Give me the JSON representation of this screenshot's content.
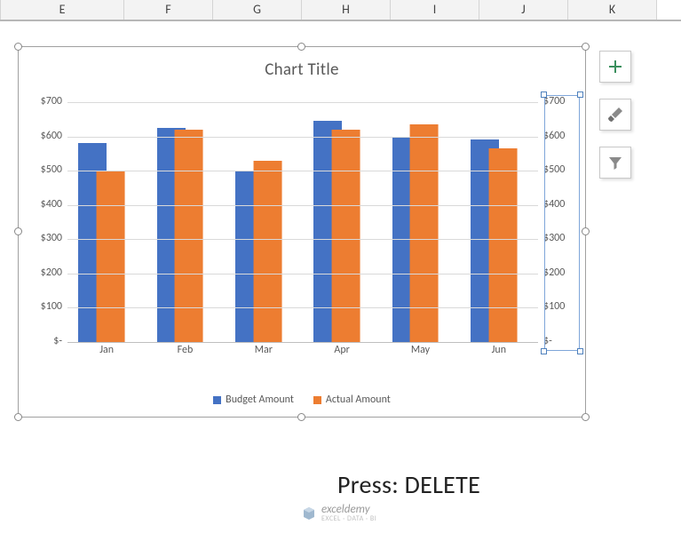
{
  "columns": {
    "widths": [
      140,
      100,
      100,
      100,
      100,
      100,
      100
    ],
    "labels": [
      "E",
      "F",
      "G",
      "H",
      "I",
      "J",
      "K"
    ]
  },
  "chart_data": {
    "type": "bar",
    "title": "Chart Title",
    "categories": [
      "Jan",
      "Feb",
      "Mar",
      "Apr",
      "May",
      "Jun"
    ],
    "series": [
      {
        "name": "Budget Amount",
        "color": "#4472C4",
        "values": [
          580,
          625,
          500,
          645,
          600,
          590
        ]
      },
      {
        "name": "Actual Amount",
        "color": "#ED7D31",
        "values": [
          500,
          620,
          530,
          620,
          635,
          565
        ]
      }
    ],
    "ylim": [
      0,
      700
    ],
    "ytick_labels": [
      "$700",
      "$600",
      "$500",
      "$400",
      "$300",
      "$200",
      "$100",
      "$-"
    ],
    "secondary_ytick_labels": [
      "$700",
      "$600",
      "$500",
      "$400",
      "$300",
      "$200",
      "$100",
      "$-"
    ],
    "legend_position": "bottom"
  },
  "annotation": "Press: DELETE",
  "watermark": {
    "brand": "exceldemy",
    "tagline": "EXCEL · DATA · BI"
  },
  "side_buttons": [
    "plus",
    "brush",
    "funnel"
  ],
  "selected_element": "secondary-axis"
}
